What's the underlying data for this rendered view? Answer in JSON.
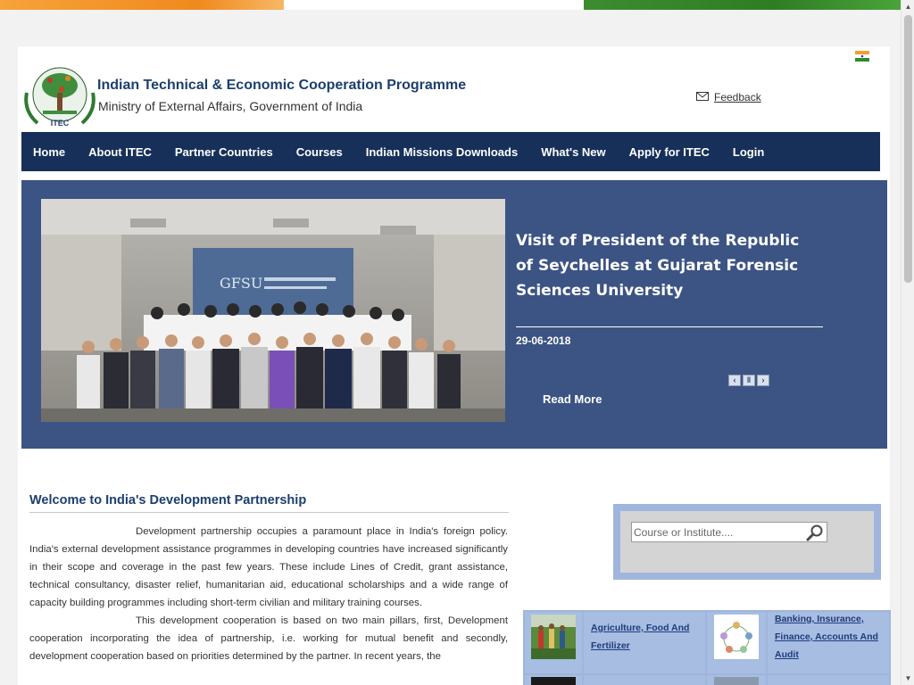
{
  "header": {
    "title": "Indian Technical & Economic Cooperation Programme",
    "subtitle": "Ministry of External Affairs, Government of India",
    "logo_text": "ITEC",
    "feedback_label": "Feedback"
  },
  "nav": {
    "items": [
      {
        "label": "Home"
      },
      {
        "label": "About ITEC"
      },
      {
        "label": "Partner Countries"
      },
      {
        "label": "Courses"
      },
      {
        "label": "Indian Missions Downloads"
      },
      {
        "label": "What's New"
      },
      {
        "label": "Apply for ITEC"
      },
      {
        "label": "Login"
      }
    ]
  },
  "slider": {
    "title": "Visit of President of the Republic of Seychelles at Gujarat Forensic Sciences University",
    "date": "29-06-2018",
    "read_more": "Read More",
    "photo_screen_text": "GFSU"
  },
  "welcome": {
    "title": "Welcome to India's Development Partnership",
    "paragraph1": "Development partnership occupies a paramount place in India's foreign policy. India's external development assistance programmes in developing countries have increased significantly in their scope and coverage in the past few years. These include Lines of Credit, grant assistance, technical consultancy, disaster relief, humanitarian aid, educational scholarships and a wide range of capacity building programmes including short-term civilian and military training courses.",
    "paragraph2": "This development cooperation is based on two main pillars, first, Development cooperation incorporating the idea of partnership, i.e. working for mutual benefit and secondly, development cooperation based on priorities determined by the partner. In recent years, the"
  },
  "search": {
    "placeholder": "Course or Institute...."
  },
  "courses": {
    "items": [
      {
        "label": "Agriculture, Food And Fertilizer"
      },
      {
        "label": "Banking, Insurance, Finance, Accounts And Audit"
      }
    ]
  },
  "colors": {
    "nav_bg": "#16305a",
    "slider_bg": "#3c5483",
    "search_bg": "#9fb5dc",
    "title_blue": "#1c3f6e"
  }
}
